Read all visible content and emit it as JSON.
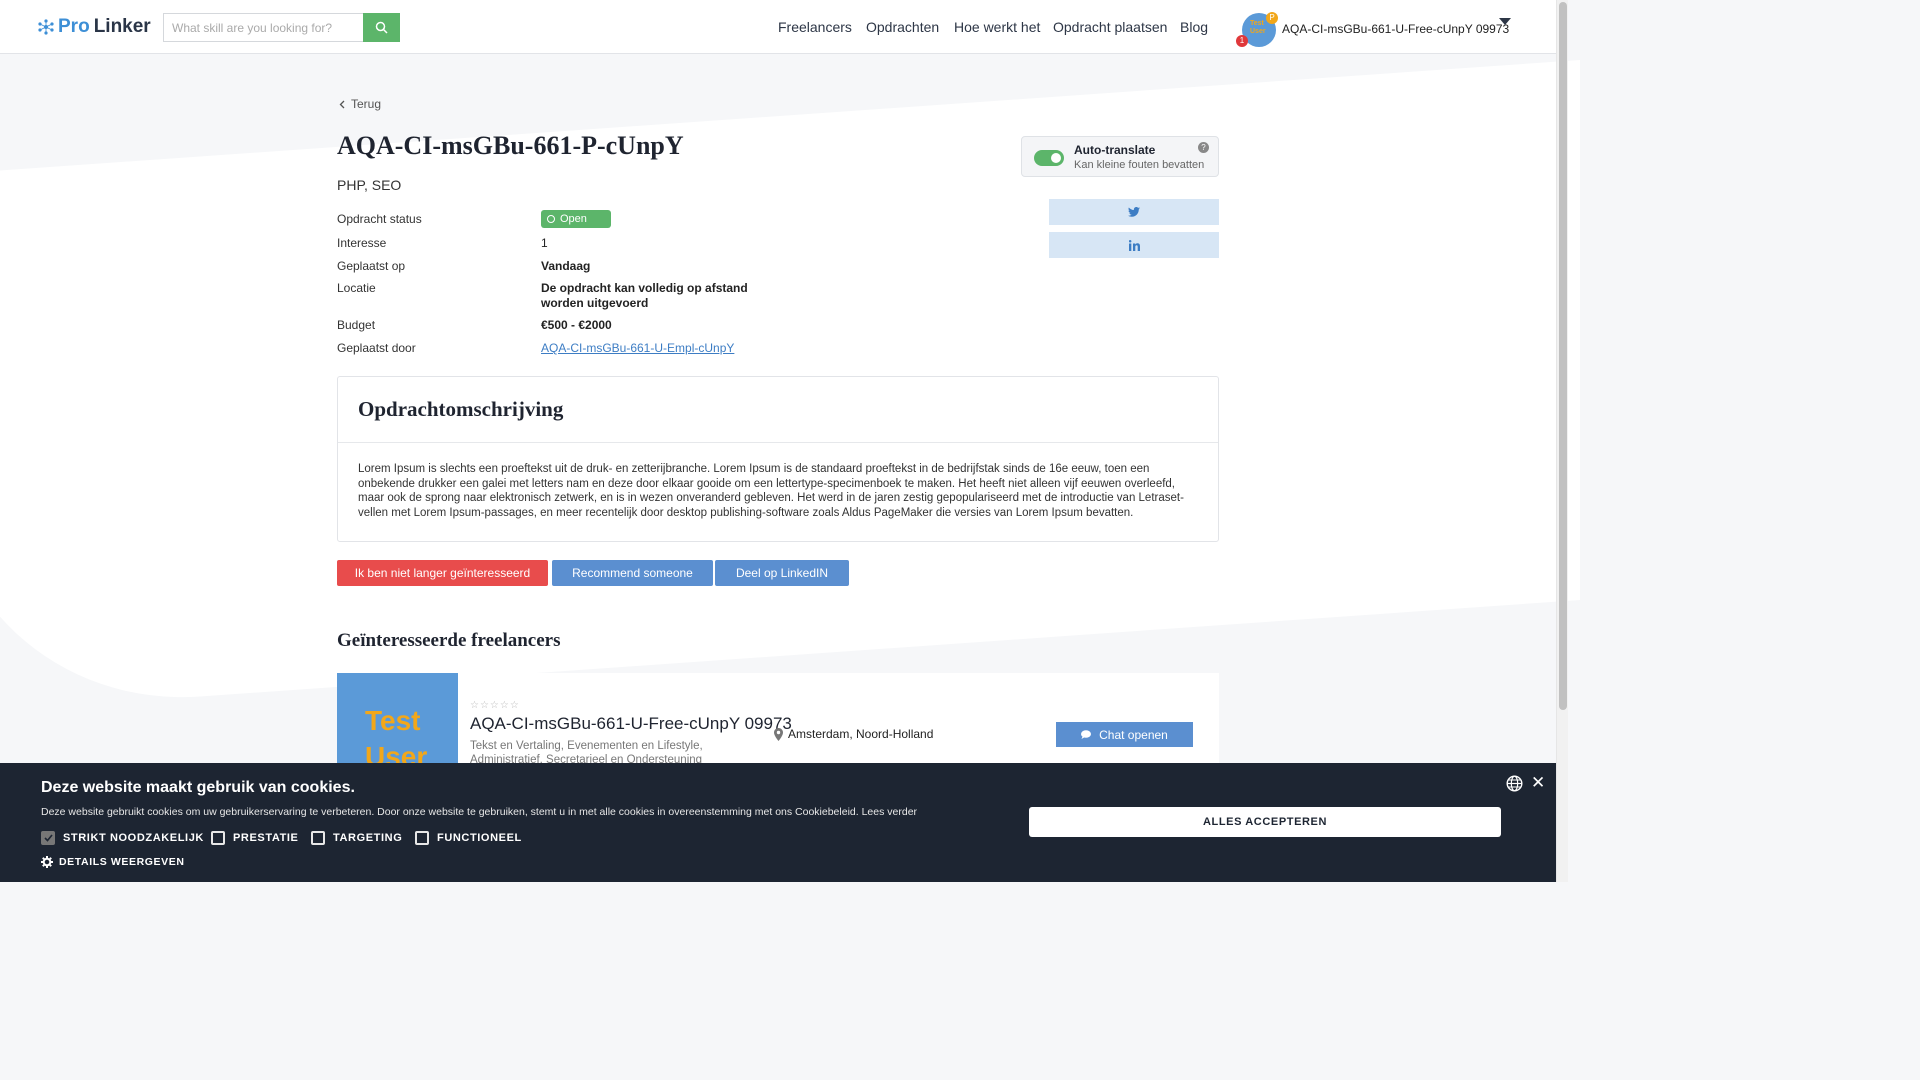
{
  "header": {
    "logo_pro": "Pro",
    "logo_linker": "Linker",
    "search_placeholder": "What skill are you looking for?",
    "nav": [
      "Freelancers",
      "Opdrachten",
      "Hoe werkt het",
      "Opdracht plaatsen",
      "Blog"
    ],
    "avatar_text": "Test User",
    "points_badge": "P",
    "notification_count": "1",
    "username": "AQA-CI-msGBu-661-U-Free-cUnpY 09973"
  },
  "page": {
    "back_label": "Terug",
    "title": "AQA-CI-msGBu-661-P-cUnpY",
    "skills": "PHP, SEO"
  },
  "details": {
    "status_label": "Opdracht status",
    "status_value": "Open",
    "interest_label": "Interesse",
    "interest_value": "1",
    "posted_label": "Geplaatst op",
    "posted_value": "Vandaag",
    "location_label": "Locatie",
    "location_value_line1": "De opdracht kan volledig op afstand",
    "location_value_line2": "worden uitgevoerd",
    "budget_label": "Budget",
    "budget_value": "€500 - €2000",
    "posted_by_label": "Geplaatst door",
    "posted_by_value": "AQA-CI-msGBu-661-U-Empl-cUnpY"
  },
  "translate": {
    "title": "Auto-translate",
    "subtitle": "Kan kleine fouten bevatten",
    "help": "?"
  },
  "description": {
    "heading": "Opdrachtomschrijving",
    "text": "Lorem Ipsum is slechts een proeftekst uit de druk- en zetterijbranche. Lorem Ipsum is de standaard proeftekst in de bedrijfstak sinds de 16e eeuw, toen een onbekende drukker een galei met letters nam en deze door elkaar gooide om een lettertype-specimenboek te maken. Het heeft niet alleen vijf eeuwen overleefd, maar ook de sprong naar elektronisch zetwerk, en is in wezen onveranderd gebleven. Het werd in de jaren zestig gepopulariseerd met de introductie van Letraset-vellen met Lorem Ipsum-passages, en meer recentelijk door desktop publishing-software zoals Aldus PageMaker die versies van Lorem Ipsum bevatten."
  },
  "actions": {
    "not_interested": "Ik ben niet langer geïnteresseerd",
    "recommend": "Recommend someone",
    "share_linkedin": "Deel op LinkedIN"
  },
  "interested": {
    "heading": "Geïnteresseerde freelancers",
    "freelancer": {
      "avatar_text_1": "Test",
      "avatar_text_2": "User",
      "stars": "☆☆☆☆☆",
      "rating": 0,
      "name": "AQA-CI-msGBu-661-U-Free-cUnpY 09973",
      "location": "Amsterdam, Noord-Holland",
      "tags_line1": "Tekst en Vertaling, Evenementen en Lifestyle,",
      "tags_line2": "Administratief, Secretarieel en Ondersteuning",
      "chat_label": "Chat openen"
    }
  },
  "cookie": {
    "title": "Deze website maakt gebruik van cookies.",
    "description": "Deze website gebruikt cookies om uw gebruikerservaring te verbeteren. Door onze website te gebruiken, stemt u in met alle cookies in overeenstemming met ons Cookiebeleid. Lees verder",
    "options": [
      {
        "label": "STRIKT NOODZAKELIJK",
        "checked": true
      },
      {
        "label": "PRESTATIE",
        "checked": false
      },
      {
        "label": "TARGETING",
        "checked": false
      },
      {
        "label": "FUNCTIONEEL",
        "checked": false
      }
    ],
    "details_label": "DETAILS WEERGEVEN",
    "accept_label": "ALLES ACCEPTEREN",
    "close": "✕"
  },
  "colors": {
    "brand_blue": "#3d8fd6",
    "green": "#5cb56a",
    "red": "#e84c4c",
    "button_blue": "#5b8fd0",
    "cookie_bg": "#1d2532"
  }
}
